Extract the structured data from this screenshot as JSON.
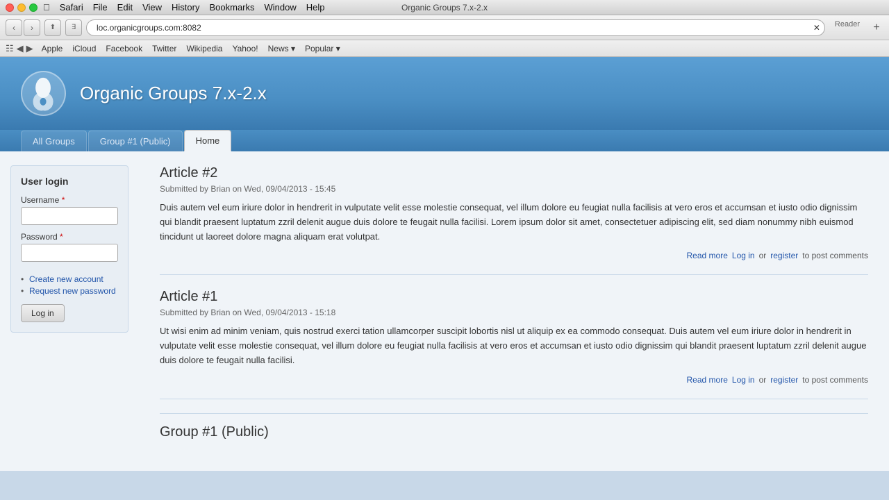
{
  "window": {
    "title": "Organic Groups 7.x-2.x"
  },
  "titlebar": {
    "menus": [
      "Apple",
      "Safari",
      "File",
      "Edit",
      "View",
      "History",
      "Bookmarks",
      "Window",
      "Help"
    ]
  },
  "toolbar": {
    "url": "loc.organicgroups.com:8082",
    "reader_label": "Reader"
  },
  "bookmarks": {
    "links": [
      "Apple",
      "iCloud",
      "Facebook",
      "Twitter",
      "Wikipedia",
      "Yahoo!"
    ],
    "dropdowns": [
      "News ⌄",
      "Popular ⌄"
    ]
  },
  "site": {
    "title": "Organic Groups 7.x-2.x",
    "tabs": [
      {
        "label": "All Groups",
        "active": false
      },
      {
        "label": "Group #1 (Public)",
        "active": false
      },
      {
        "label": "Home",
        "active": true
      }
    ]
  },
  "sidebar": {
    "login_title": "User login",
    "username_label": "Username",
    "password_label": "Password",
    "create_account": "Create new account",
    "request_password": "Request new password",
    "login_button": "Log in"
  },
  "articles": [
    {
      "title": "Article #2",
      "meta": "Submitted by Brian on Wed, 09/04/2013 - 15:45",
      "body": "Duis autem vel eum iriure dolor in hendrerit in vulputate velit esse molestie consequat, vel illum dolore eu feugiat nulla facilisis at vero eros et accumsan et iusto odio dignissim qui blandit praesent luptatum zzril delenit augue duis dolore te feugait nulla facilisi. Lorem ipsum dolor sit amet, consectetuer adipiscing elit, sed diam nonummy nibh euismod tincidunt ut laoreet dolore magna aliquam erat volutpat.",
      "read_more": "Read more",
      "log_in": "Log in",
      "or_text": "or",
      "register": "register",
      "post_comments": "to post comments"
    },
    {
      "title": "Article #1",
      "meta": "Submitted by Brian on Wed, 09/04/2013 - 15:18",
      "body": "Ut wisi enim ad minim veniam, quis nostrud exerci tation ullamcorper suscipit lobortis nisl ut aliquip ex ea commodo consequat. Duis autem vel eum iriure dolor in hendrerit in vulputate velit esse molestie consequat, vel illum dolore eu feugiat nulla facilisis at vero eros et accumsan et iusto odio dignissim qui blandit praesent luptatum zzril delenit augue duis dolore te feugait nulla facilisi.",
      "read_more": "Read more",
      "log_in": "Log in",
      "or_text": "or",
      "register": "register",
      "post_comments": "to post comments"
    }
  ],
  "partial": {
    "title": "Group #1 (Public)"
  }
}
